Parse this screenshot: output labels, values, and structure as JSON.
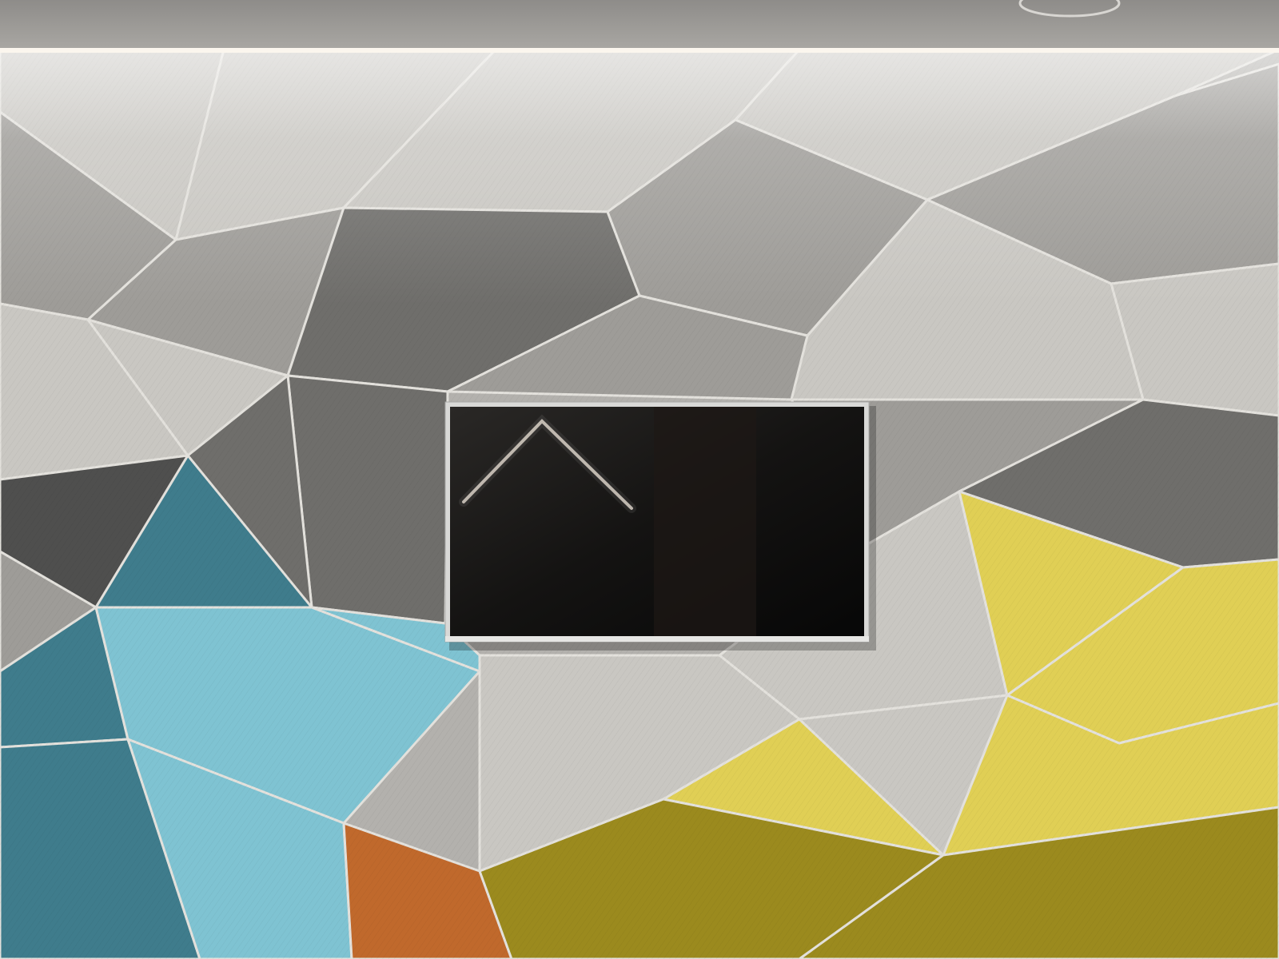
{
  "scene": {
    "subject": "faceted-polygon-wall-with-mounted-tv",
    "palette": {
      "ceiling": "#9c9a97",
      "ceiling_light": "#fbf6ee",
      "gray_light": "#c9c7c2",
      "gray_mid": "#9e9c98",
      "gray_dark": "#6f6e6b",
      "gray_shadow": "#4f4f4e",
      "teal_dark": "#3f7c8c",
      "teal_light": "#7fc3d2",
      "yellow_light": "#e0cf55",
      "yellow_dark": "#9b8a1e",
      "orange": "#c0692c",
      "seam": "#e3e1dc",
      "tv_frame": "#d9d9d7",
      "tv_screen": "#0d0c0c"
    },
    "icons": [
      "ceiling-sprinkler-icon"
    ]
  }
}
